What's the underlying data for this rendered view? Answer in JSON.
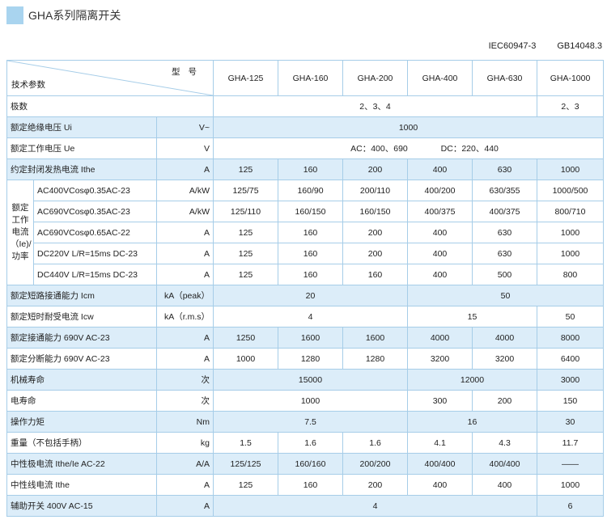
{
  "header": {
    "title": "GHA系列隔离开关"
  },
  "standards": [
    "IEC60947-3",
    "GB14048.3"
  ],
  "table": {
    "corner_top": "型号",
    "corner_bottom": "技术参数",
    "models": [
      "GHA-125",
      "GHA-160",
      "GHA-200",
      "GHA-400",
      "GHA-630",
      "GHA-1000"
    ],
    "poles": {
      "label": "极数",
      "v1": "2、3、4",
      "v2": "2、3"
    },
    "ui": {
      "label": "额定绝缘电压 Ui",
      "unit": "V~",
      "v": "1000"
    },
    "ue": {
      "label": "额定工作电压 Ue",
      "unit": "V",
      "ac": "AC：400、690",
      "dc": "DC：220、440"
    },
    "ithe": {
      "label": "约定封闭发热电流 Ithe",
      "unit": "A",
      "values": [
        "125",
        "160",
        "200",
        "400",
        "630",
        "1000"
      ]
    },
    "ie_group": {
      "label": "额定工作电流（Ie)/功率"
    },
    "ie_rows": [
      {
        "label": "AC400VCosφ0.35AC-23",
        "unit": "A/kW",
        "values": [
          "125/75",
          "160/90",
          "200/110",
          "400/200",
          "630/355",
          "1000/500"
        ]
      },
      {
        "label": "AC690VCosφ0.35AC-23",
        "unit": "A/kW",
        "values": [
          "125/110",
          "160/150",
          "160/150",
          "400/375",
          "400/375",
          "800/710"
        ]
      },
      {
        "label": "AC690VCosφ0.65AC-22",
        "unit": "A",
        "values": [
          "125",
          "160",
          "200",
          "400",
          "630",
          "1000"
        ]
      },
      {
        "label": "DC220V  L/R=15ms  DC-23",
        "unit": "A",
        "values": [
          "125",
          "160",
          "200",
          "400",
          "630",
          "1000"
        ]
      },
      {
        "label": "DC440V  L/R=15ms  DC-23",
        "unit": "A",
        "values": [
          "125",
          "160",
          "160",
          "400",
          "500",
          "800"
        ]
      }
    ],
    "icm": {
      "label": "额定短路接通能力 Icm",
      "unit": "kA（peak）",
      "v1": "20",
      "v2": "50"
    },
    "icw": {
      "label": "额定短时耐受电流 Icw",
      "unit": "kA（r.m.s）",
      "v1": "4",
      "v2": "15",
      "v3": "50"
    },
    "make": {
      "label": "额定接通能力 690V AC-23",
      "unit": "A",
      "values": [
        "1250",
        "1600",
        "1600",
        "4000",
        "4000",
        "8000"
      ]
    },
    "break": {
      "label": "额定分断能力 690V AC-23",
      "unit": "A",
      "values": [
        "1000",
        "1280",
        "1280",
        "3200",
        "3200",
        "6400"
      ]
    },
    "mech_life": {
      "label": "机械寿命",
      "unit": "次",
      "v1": "15000",
      "v2": "12000",
      "v3": "3000"
    },
    "elec_life": {
      "label": "电寿命",
      "unit": "次",
      "v1": "1000",
      "v2": "300",
      "v3": "200",
      "v4": "150"
    },
    "torque": {
      "label": "操作力矩",
      "unit": "Nm",
      "v1": "7.5",
      "v2": "16",
      "v3": "30"
    },
    "weight": {
      "label": "重量（不包括手柄）",
      "unit": "kg",
      "values": [
        "1.5",
        "1.6",
        "1.6",
        "4.1",
        "4.3",
        "11.7"
      ]
    },
    "neutral_pole": {
      "label": "中性极电流 Ithe/Ie AC-22",
      "unit": "A/A",
      "values": [
        "125/125",
        "160/160",
        "200/200",
        "400/400",
        "400/400",
        "——"
      ]
    },
    "neutral_line": {
      "label": "中性线电流 Ithe",
      "unit": "A",
      "values": [
        "125",
        "160",
        "200",
        "400",
        "400",
        "1000"
      ]
    },
    "aux": {
      "label": "辅助开关 400V    AC-15",
      "unit": "A",
      "v1": "4",
      "v2": "6"
    }
  }
}
